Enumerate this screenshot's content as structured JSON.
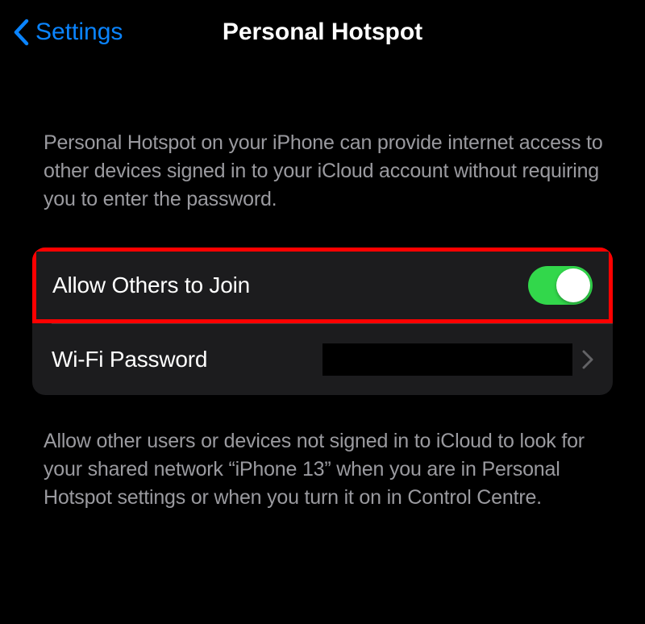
{
  "header": {
    "back_label": "Settings",
    "title": "Personal Hotspot"
  },
  "intro_text": "Personal Hotspot on your iPhone can provide internet access to other devices signed in to your iCloud account without requiring you to enter the password.",
  "cells": {
    "allow_others": {
      "label": "Allow Others to Join"
    },
    "wifi_password": {
      "label": "Wi-Fi Password"
    }
  },
  "footer_text": "Allow other users or devices not signed in to iCloud to look for your shared network “iPhone 13” when you are in Personal Hotspot settings or when you turn it on in Control Centre."
}
